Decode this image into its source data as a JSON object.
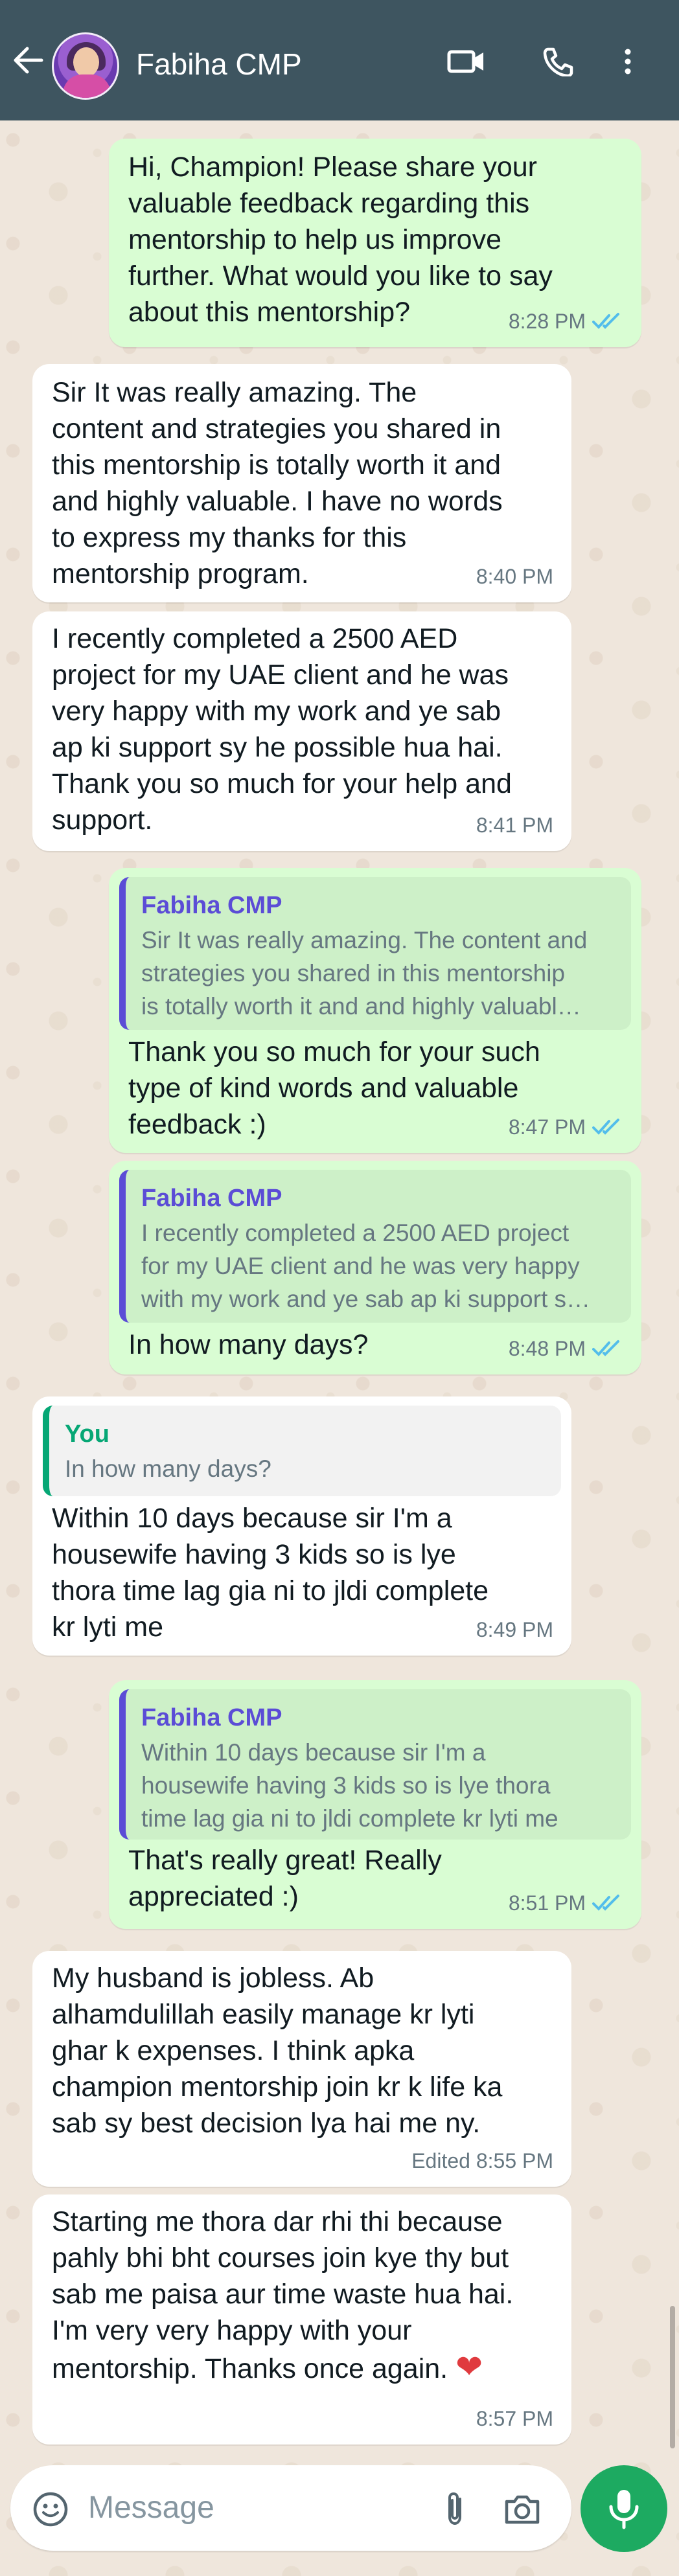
{
  "header": {
    "contact_name": "Fabiha CMP"
  },
  "messages": [
    {
      "text": "Hi, Champion! Please share your\nvaluable feedback regarding this\nmentorship to help us improve\nfurther. What would you like to say\nabout this mentorship?",
      "time": "8:28 PM"
    },
    {
      "text": "Sir It was really amazing. The\ncontent and strategies you shared in\nthis mentorship is totally worth it and\nand highly valuable. I have no words\nto express my thanks for this\nmentorship program.",
      "time": "8:40 PM"
    },
    {
      "text": "I recently completed a 2500 AED\nproject for my UAE client and he was\nvery happy with my work and ye sab\nap ki support sy he possible hua hai.\nThank you so much for your help and\nsupport.",
      "time": "8:41 PM"
    },
    {
      "quote_name": "Fabiha CMP",
      "quote_text": "Sir It was really amazing. The content and\nstrategies you shared in this mentorship\nis totally worth it and and highly valuabl…",
      "text": "Thank you so much for your such\ntype of kind words and valuable\nfeedback :)",
      "time": "8:47 PM"
    },
    {
      "quote_name": "Fabiha CMP",
      "quote_text": "I recently completed a 2500 AED project\nfor my UAE client and he was very happy\nwith my work and ye sab ap ki support s…",
      "text": "In how many days?",
      "time": "8:48 PM"
    },
    {
      "quote_name": "You",
      "quote_text": "In how many days?",
      "text": "Within 10 days because sir I'm a\nhousewife having 3 kids so is lye\nthora time lag gia ni to jldi complete\nkr lyti me",
      "time": "8:49 PM"
    },
    {
      "quote_name": "Fabiha CMP",
      "quote_text": "Within 10 days because sir I'm a\nhousewife having 3 kids so is lye thora\ntime lag gia ni to jldi complete kr lyti me",
      "text": "That's really great! Really\nappreciated :)",
      "time": "8:51 PM"
    },
    {
      "text": "My husband is jobless. Ab\nalhamdulillah easily manage kr lyti\nghar k expenses. I think apka\nchampion mentorship join kr k life ka\nsab sy best decision lya hai me ny.",
      "time": "Edited 8:55 PM"
    },
    {
      "text": "Starting me thora dar rhi thi because\npahly bhi bht courses join kye thy but\nsab me paisa aur time waste hua hai.\nI'm very very happy with your\nmentorship. Thanks once again.",
      "emoji": "❤",
      "time": "8:57 PM"
    }
  ],
  "composer": {
    "placeholder": "Message"
  },
  "colors": {
    "header": "#3e5560",
    "outgoing_bubble": "#d9fdd3",
    "incoming_bubble": "#ffffff",
    "mic_button": "#1daa61",
    "read_ticks": "#53bdeb",
    "quote_bar": "#5b4cd6"
  }
}
